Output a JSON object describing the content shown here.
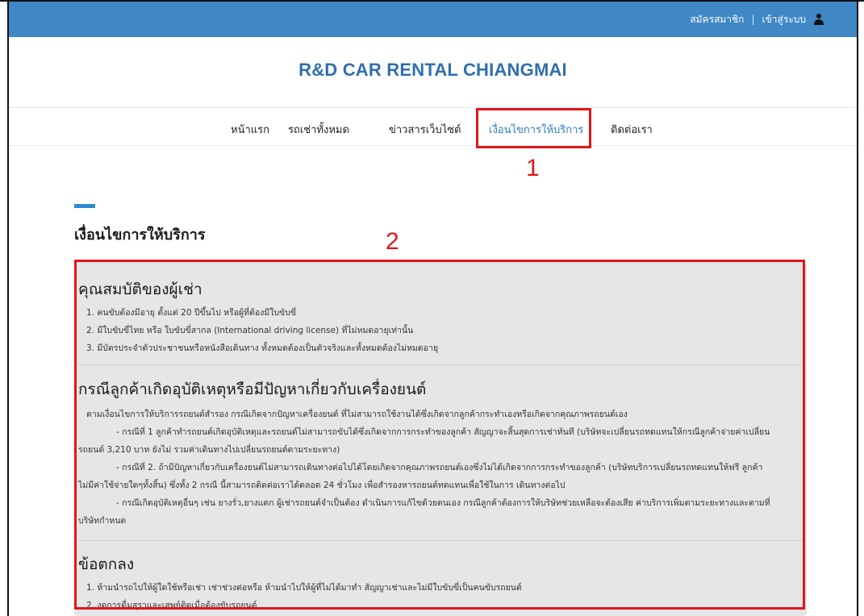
{
  "topbar": {
    "register_label": "สมัครสมาชิก",
    "separator": "|",
    "login_label": "เข้าสู่ระบบ"
  },
  "brand": {
    "title": "R&D CAR RENTAL CHIANGMAI"
  },
  "nav": {
    "items": [
      {
        "label": "หน้าแรก"
      },
      {
        "label": "รถเช่าทั้งหมด"
      },
      {
        "label": "ข่าวสารเว็บไซต์"
      },
      {
        "label": "เงื่อนไขการให้บริการ"
      },
      {
        "label": "ติดต่อเรา"
      }
    ],
    "active_index": 3
  },
  "annotations": {
    "marker_1": "1",
    "marker_2": "2"
  },
  "page": {
    "title": "เงื่อนไขการให้บริการ"
  },
  "sections": [
    {
      "heading": "คุณสมบัติของผู้เช่า",
      "lines": [
        "1. คนขับต้องมีอายุ ตั้งแต่ 20 ปีขึ้นไป หรือผู้ที่ต้องมีใบขับขี่",
        "2. มีใบขับขี่ไทย หรือ ใบขับขี่สากล (International driving license) ที่ไม่หมดอายุเท่านั้น",
        "3. มีบัตรประจำตัวประชาชนหรือหนังสือเดินทาง ทั้งหมดต้องเป็นตัวจริงและทั้งหมดต้องไม่หมดอายุ"
      ]
    },
    {
      "heading": "กรณีลูกค้าเกิดอุบัติเหตุหรือมีปัญหาเกี่ยวกับเครื่องยนต์",
      "lines": [
        "ตามเงื่อนไขการให้บริการรถยนต์สำรอง กรณีเกิดจากปัญหาเครื่องยนต์ ที่ไม่สามารถใช้งานได้ซึ่งเกิดจากลูกค้ากระทำเองหรือเกิดจากคุณภาพรถยนต์เอง",
        "- กรณีที่ 1 ลูกค้าทำรถยนต์เกิดอุบัติเหตุและรถยนต์ไม่สามารถขับได้ซึ่งเกิดจากการกระทำของลูกค้า สัญญาจะสิ้นสุดการเช่าทันที (บริษัทจะเปลี่ยนรถทดแทนให้กรณีลูกค้าจ่ายค่าเปลี่ยน",
        "รถยนต์ 3,210 บาท ยังไม่ รวมค่าเดินทางไปเปลี่ยนรถยนต์ตามระยะทาง)",
        "- กรณีที่ 2. ถ้ามีปัญหาเกี่ยวกับเครื่องยนต์ไม่สามารถเดินทางต่อไปได้โดยเกิดจากคุณภาพรถยนต์เองซึ่งไม่ได้เกิดจากการกระทำของลูกค้า (บริษัทบริการเปลี่ยนรถทดแทนให้ฟรี ลูกค้า",
        "ไม่มีค่าใช้จ่ายใดๆทั้งสิ้น) ซึ่งทั้ง 2 กรณี นี้สามารถติดต่อเราได้ตลอด 24 ชั่วโมง เพื่อสำรองหารถยนต์ทดแทนเพื่อใช้ในการ เดินทางต่อไป",
        "- กรณีเกิดอุบัติเหตุอื่นๆ เช่น ยางรั่ว,ยางแตก ผู้เช่ารถยนต์จำเป็นต้อง ดำเนินการแก้ไขด้วยตนเอง กรณีลูกค้าต้องการให้บริษัทช่วยเหลือจะต้องเสีย ค่าบริการเพิ่มตามระยะทางและตามที่",
        "บริษัทกำหนด"
      ]
    },
    {
      "heading": "ข้อตกลง",
      "lines": [
        "1. ห้ามนำรถไปให้ผู้ใดใช้หรือเช่า เช่าช่วงต่อหรือ ห้ามนำไปให้ผู้ที่ไม่ได้มาทำ สัญญาเช่าและไม่มีใบขับขี่เป็นคนขับรถยนต์",
        "2. งดการดื่มสุราและเสพย์ติดเมื่อต้องขับรถยนต์"
      ]
    }
  ],
  "colors": {
    "topbar": "#3f88c5",
    "brand": "#2f6fae",
    "nav_active": "#2f7dc4",
    "annotation": "#e0161b",
    "content_bg": "#e6e6e6"
  },
  "icons": {
    "user": "user-icon"
  }
}
